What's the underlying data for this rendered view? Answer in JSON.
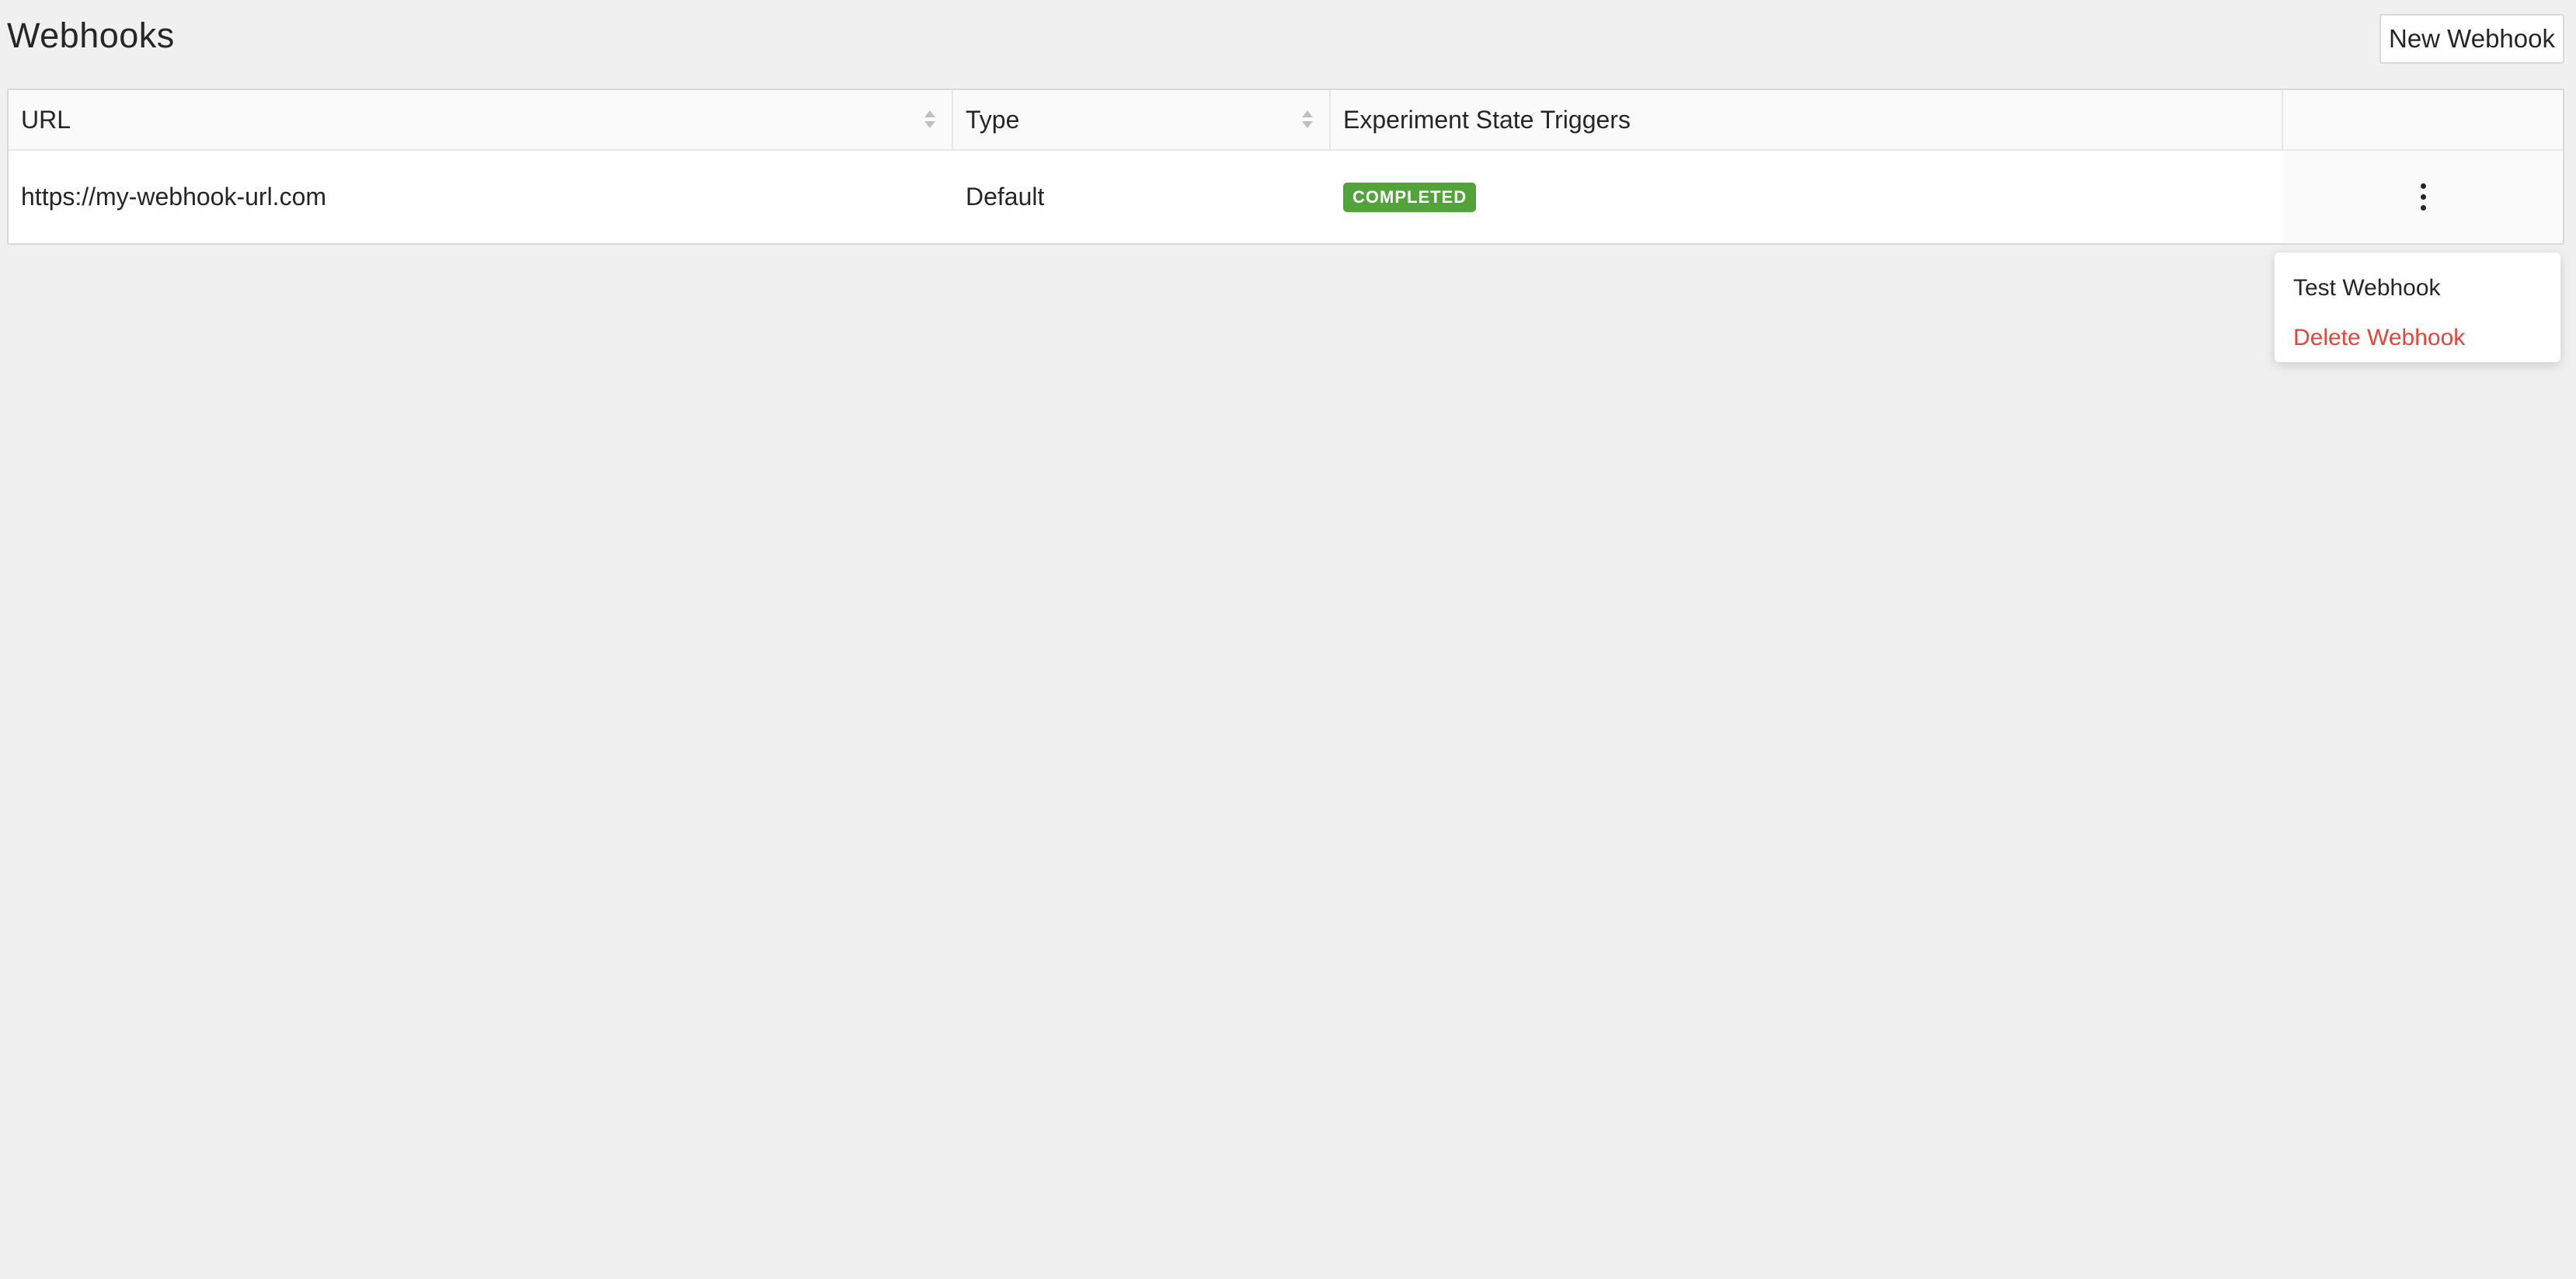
{
  "page": {
    "title": "Webhooks"
  },
  "toolbar": {
    "new_webhook_label": "New Webhook"
  },
  "table": {
    "columns": [
      {
        "label": "URL",
        "sortable": true
      },
      {
        "label": "Type",
        "sortable": true
      },
      {
        "label": "Experiment State Triggers",
        "sortable": false
      },
      {
        "label": "",
        "sortable": false
      }
    ],
    "rows": [
      {
        "url": "https://my-webhook-url.com",
        "type": "Default",
        "triggers": [
          "COMPLETED"
        ],
        "actions_icon": "more-vertical-icon"
      }
    ]
  },
  "actions_menu": {
    "items": [
      {
        "label": "Test Webhook",
        "tone": "default"
      },
      {
        "label": "Delete Webhook",
        "tone": "danger"
      }
    ]
  },
  "colors": {
    "background": "#f0f0f0",
    "badge_completed": "#52a43a",
    "danger": "#e5453a"
  }
}
